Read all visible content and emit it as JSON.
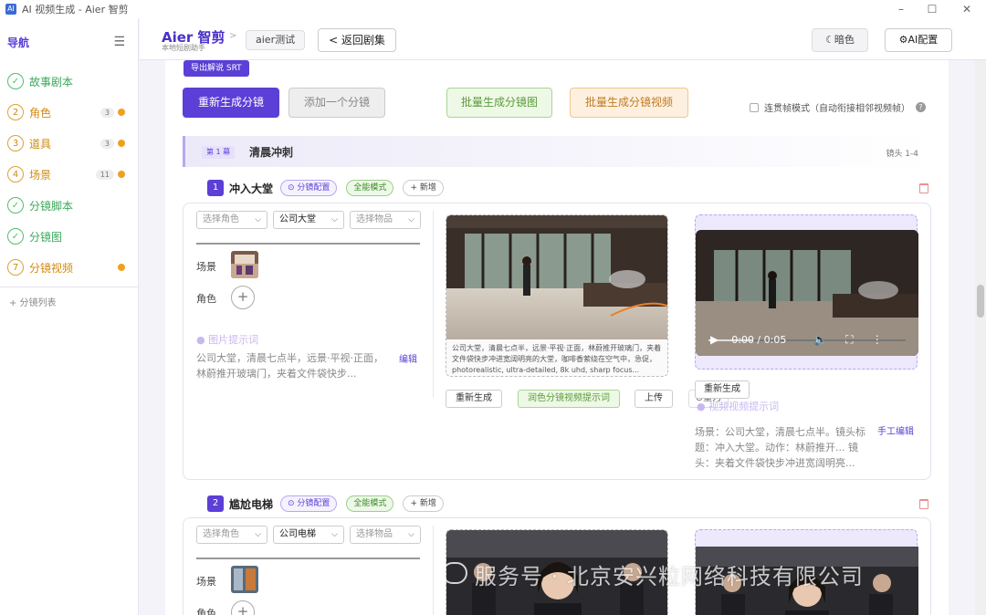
{
  "window": {
    "title": "AI 视频生成 - Aier 智剪",
    "logo": "AI",
    "minimize": "–",
    "maximize": "☐",
    "close": "✕"
  },
  "sidebar": {
    "header": "导航",
    "items": [
      {
        "num": "✓",
        "label": "故事剧本",
        "done": true
      },
      {
        "num": "2",
        "label": "角色",
        "count": "3",
        "warn": true
      },
      {
        "num": "3",
        "label": "道具",
        "count": "3",
        "warn": true
      },
      {
        "num": "4",
        "label": "场景",
        "count": "11",
        "warn": true
      },
      {
        "num": "✓",
        "label": "分镜脚本",
        "done": true
      },
      {
        "num": "✓",
        "label": "分镜图",
        "done": true
      },
      {
        "num": "7",
        "label": "分镜视频",
        "warn": true
      }
    ],
    "shot_list": "+ 分镜列表"
  },
  "topbar": {
    "brand": "Aier 智剪",
    "brand_sub": "本地短剧助手",
    "crumb_sep": ">",
    "project": "aier测试",
    "back": "< 返回剧集",
    "dark": "☾暗色",
    "ai_config": "⚙AI配置"
  },
  "toolbar": {
    "export_srt": "导出解说 SRT",
    "regen": "重新生成分镜",
    "add_one": "添加一个分镜",
    "batch_images": "批量生成分镜图",
    "batch_videos": "批量生成分镜视频",
    "continuous": "连贯帧模式（自动衔接相邻视频帧）",
    "help": "?"
  },
  "chapter": {
    "tag": "第 1 幕",
    "title": "清晨冲刺",
    "range": "镜头 1-4"
  },
  "common": {
    "cfg": "⊙ 分镜配置",
    "mode": "全能模式",
    "add": "+ 新增",
    "scene_label": "场景",
    "role_label": "角色",
    "plus": "+",
    "pp_label": "● 图片提示词",
    "edit": "编辑",
    "regen": "重新生成",
    "polish": "润色分镜视频提示词",
    "upload": "上传",
    "redo": "⊙重为",
    "vid_regen": "重新生成",
    "vp_label": "● 视频视频提示词",
    "manual_edit": "手工编辑"
  },
  "shots": [
    {
      "num": "1",
      "title": "冲入大堂",
      "role_select": "选择角色",
      "scene_select": "公司大堂",
      "prop_select": "选择物品",
      "prompt": "公司大堂，清晨七点半，远景·平视·正面，林蔚推开玻璃门，夹着文件袋快步...",
      "caption": "公司大堂，清晨七点半，远景·平视·正面，林蔚推开玻璃门，夹着文件袋快步冲进宽阔明亮的大堂，咖啡香萦绕在空气中，急促，photorealistic, ultra-detailed, 8k uhd, sharp focus...",
      "time": "0:00 / 0:05",
      "video_prompt": "场景：公司大堂，清晨七点半。镜头标题：冲入大堂。动作：林蔚推开... 镜头：夹着文件袋快步冲进宽阔明亮..."
    },
    {
      "num": "2",
      "title": "尴尬电梯",
      "role_select": "选择角色",
      "scene_select": "公司电梯",
      "prop_select": "选择物品"
    }
  ],
  "watermark": "服务号 · 北京安兴粒网络科技有限公司",
  "colors": {
    "accent": "#5b3fd6",
    "green": "#4fbf6a",
    "orange": "#e0a030"
  }
}
